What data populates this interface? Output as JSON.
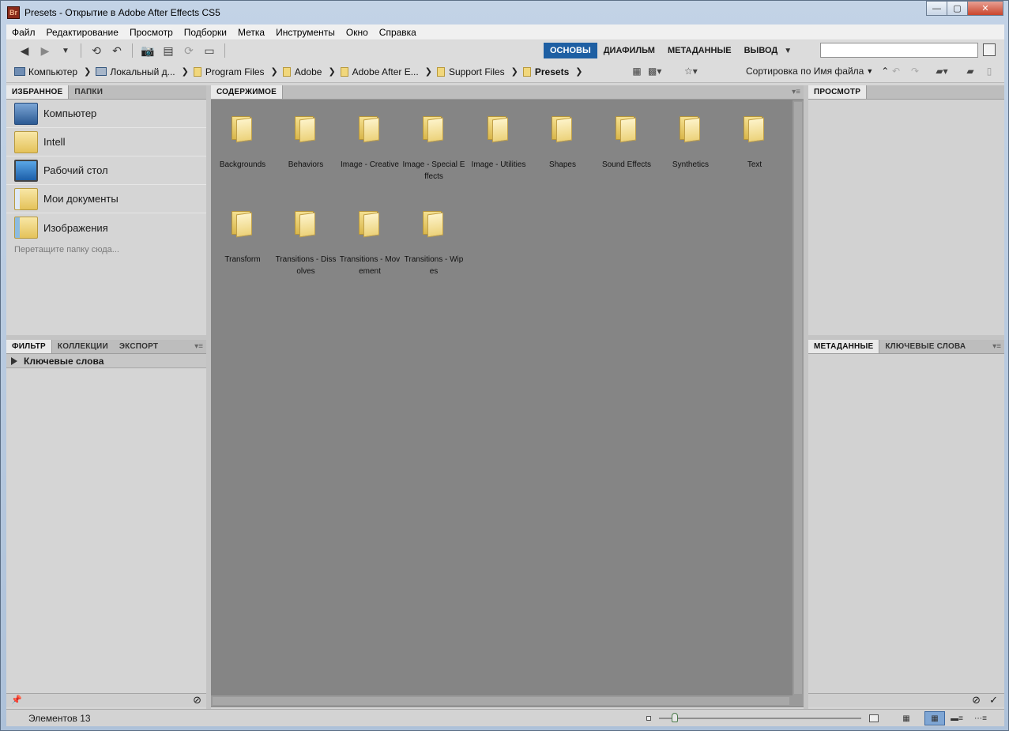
{
  "window": {
    "title": "Presets - Открытие в Adobe After Effects CS5",
    "app_badge": "Br",
    "minimize": "—",
    "maximize": "▢",
    "close": "✕"
  },
  "menu": [
    "Файл",
    "Редактирование",
    "Просмотр",
    "Подборки",
    "Метка",
    "Инструменты",
    "Окно",
    "Справка"
  ],
  "workspaces": {
    "items": [
      "ОСНОВЫ",
      "ДИАФИЛЬМ",
      "МЕТАДАННЫЕ",
      "ВЫВОД"
    ],
    "active": "ОСНОВЫ",
    "more_arrow": "▼"
  },
  "search": {
    "value": "",
    "placeholder": ""
  },
  "breadcrumbs": [
    "Компьютер",
    "Локальный д...",
    "Program Files",
    "Adobe",
    "Adobe After E...",
    "Support Files",
    "Presets"
  ],
  "sort": {
    "label": "Сортировка по Имя файла"
  },
  "favorites_panel": {
    "tabs": [
      "ИЗБРАННОЕ",
      "ПАПКИ"
    ],
    "items": [
      {
        "label": "Компьютер",
        "icon": "computer-icon"
      },
      {
        "label": "Intell",
        "icon": "folder-icon"
      },
      {
        "label": "Рабочий стол",
        "icon": "desktop-icon"
      },
      {
        "label": "Мои документы",
        "icon": "documents-icon"
      },
      {
        "label": "Изображения",
        "icon": "pictures-icon"
      }
    ],
    "drop_hint": "Перетащите папку сюда..."
  },
  "filter_panel": {
    "tabs": [
      "ФИЛЬТР",
      "КОЛЛЕКЦИИ",
      "ЭКСПОРТ"
    ],
    "row": "Ключевые слова"
  },
  "content_panel": {
    "tab": "СОДЕРЖИМОЕ",
    "items": [
      "Backgrounds",
      "Behaviors",
      "Image - Creative",
      "Image - Special Effects",
      "Image - Utilities",
      "Shapes",
      "Sound Effects",
      "Synthetics",
      "Text",
      "Transform",
      "Transitions - Dissolves",
      "Transitions - Movement",
      "Transitions - Wipes"
    ]
  },
  "preview_panel": {
    "tab": "ПРОСМОТР"
  },
  "metadata_panel": {
    "tabs": [
      "МЕТАДАННЫЕ",
      "КЛЮЧЕВЫЕ СЛОВА"
    ]
  },
  "status": {
    "text": "Элементов 13"
  },
  "colors": {
    "active_workspace": "#1e5fa3",
    "content_bg": "#858585",
    "panel_bg": "#d5d5d5"
  }
}
